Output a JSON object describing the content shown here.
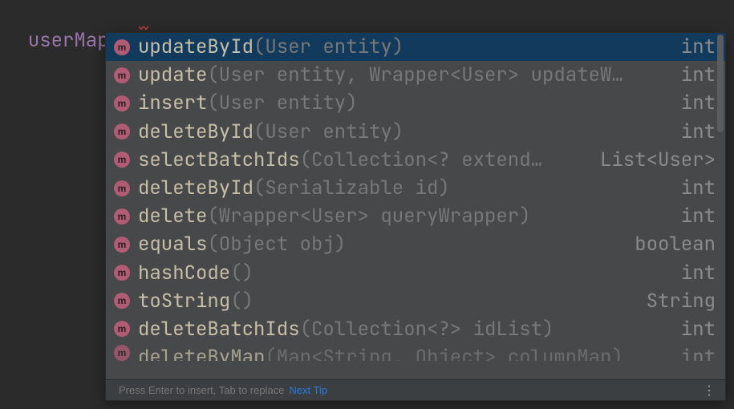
{
  "editor": {
    "variable": "userMapper",
    "dot": "."
  },
  "completion": {
    "icon_letter": "m",
    "items": [
      {
        "name": "updateById",
        "params": "(User entity)",
        "ret": "int"
      },
      {
        "name": "update",
        "params": "(User entity, Wrapper<User> updateW…",
        "ret": "int"
      },
      {
        "name": "insert",
        "params": "(User entity)",
        "ret": "int"
      },
      {
        "name": "deleteById",
        "params": "(User entity)",
        "ret": "int"
      },
      {
        "name": "selectBatchIds",
        "params": "(Collection<? extend…",
        "ret": "List<User>"
      },
      {
        "name": "deleteById",
        "params": "(Serializable id)",
        "ret": "int"
      },
      {
        "name": "delete",
        "params": "(Wrapper<User> queryWrapper)",
        "ret": "int"
      },
      {
        "name": "equals",
        "params": "(Object obj)",
        "ret": "boolean"
      },
      {
        "name": "hashCode",
        "params": "()",
        "ret": "int"
      },
      {
        "name": "toString",
        "params": "()",
        "ret": "String"
      },
      {
        "name": "deleteBatchIds",
        "params": "(Collection<?> idList)",
        "ret": "int"
      },
      {
        "name": "deleteByMap",
        "params": "(Map<String, Object> columnMap)",
        "ret": "int"
      }
    ]
  },
  "footer": {
    "hint": "Press Enter to insert, Tab to replace",
    "link": "Next Tip"
  }
}
